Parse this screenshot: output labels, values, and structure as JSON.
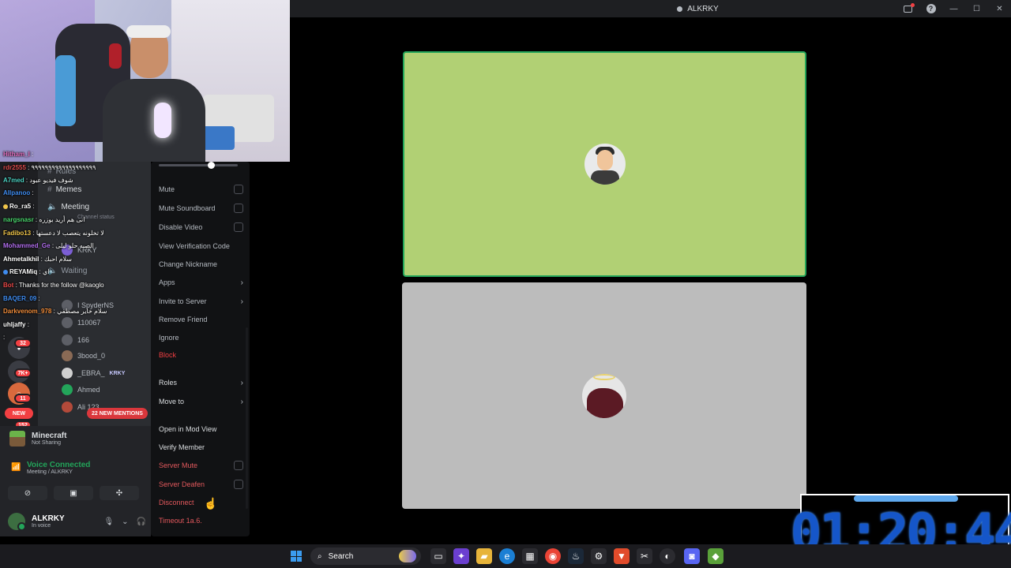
{
  "window": {
    "title": "ALKRKY"
  },
  "chat": [
    {
      "user": "Hitham_I",
      "msg": ":",
      "color": "#e26fbf"
    },
    {
      "user": "rdr2555",
      "msg": ": ٩٩٩٩٩٩٩٩٩٩٩٩٩٩٩٩٩٩٩",
      "color": "#d94b4b"
    },
    {
      "user": "A7med",
      "msg": ": شوف فيديو عبود",
      "color": "#4bd1c2"
    },
    {
      "user": "Allpanoo",
      "msg": ":",
      "color": "#3f8cf0"
    },
    {
      "user": "Ro_ra5",
      "msg": ":",
      "color": "#ffffff"
    },
    {
      "user": "nargsnasr",
      "msg": ": انی هم أريد بوزره",
      "color": "#4ad66d"
    },
    {
      "user": "Fadibo13",
      "msg": ": لا تخلونه يتعصب لا دعستها",
      "color": "#f0c54a"
    },
    {
      "user": "Mohammed_Ge",
      "msg": ": الصبه حلو ليلى",
      "color": "#b36ff0"
    },
    {
      "user": "Ahmetalkhil",
      "msg": ": سلام احبك",
      "color": "#ffffff"
    },
    {
      "user": "REYAMiq",
      "msg": ": اي",
      "color": "#ffffff"
    },
    {
      "user": "Bot",
      "msg": ": Thanks for the follow @kaoglo",
      "color": "#e84848"
    },
    {
      "user": "BAQER_09",
      "msg": ":",
      "color": "#3f8cf0"
    },
    {
      "user": "Darkvenom_978",
      "msg": ": سلام خاير مصطفي",
      "color": "#f08c3a"
    },
    {
      "user": "uhljaffy",
      "msg": ":",
      "color": "#ffffff"
    },
    {
      "user": "",
      "msg": ":",
      "color": "#4bd1c2"
    }
  ],
  "channels": {
    "rules": "Rules",
    "memes": "Memes",
    "meeting": "Meeting",
    "meeting_status": "Channel status",
    "waiting": "Waiting"
  },
  "voice_users": [
    {
      "name": "KRKY",
      "tag": ""
    },
    {
      "name": "I SpyderNS",
      "tag": ""
    },
    {
      "name": "110067",
      "tag": ""
    },
    {
      "name": "166",
      "tag": ""
    },
    {
      "name": "3bood_0",
      "tag": ""
    },
    {
      "name": "_EBRA_",
      "tag": "KRKY"
    },
    {
      "name": "Ahmed",
      "tag": ""
    },
    {
      "name": "Ali 123",
      "tag": ""
    }
  ],
  "guild_badges": [
    "32",
    "7K+",
    "11",
    "NEW",
    "152"
  ],
  "mentions_label": "22 NEW MENTIONS",
  "activity": {
    "title": "Minecraft",
    "sub": "Not Sharing"
  },
  "voice": {
    "title": "Voice Connected",
    "sub": "Meeting / ALKRKY"
  },
  "user": {
    "name": "ALKRKY",
    "status": "In voice"
  },
  "context_menu": {
    "mute": "Mute",
    "mute_soundboard": "Mute Soundboard",
    "disable_video": "Disable Video",
    "view_verification": "View Verification Code",
    "change_nickname": "Change Nickname",
    "apps": "Apps",
    "invite": "Invite to Server",
    "remove_friend": "Remove Friend",
    "ignore": "Ignore",
    "block": "Block",
    "roles": "Roles",
    "move_to": "Move to",
    "mod_view": "Open in Mod View",
    "verify_member": "Verify Member",
    "server_mute": "Server Mute",
    "server_deafen": "Server Deafen",
    "disconnect": "Disconnect",
    "timeout": "Timeout 1a.6."
  },
  "timer": "01:20:44",
  "taskbar": {
    "search_label": "Search"
  },
  "colors": {
    "speaking": "#23a55a",
    "danger": "#f23f42",
    "timer": "#1556c9"
  }
}
